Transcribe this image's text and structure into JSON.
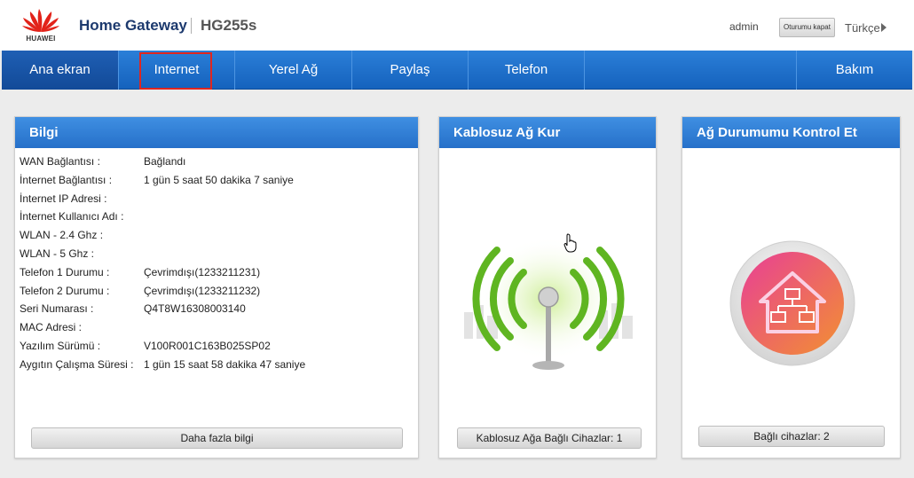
{
  "header": {
    "logo_text": "HUAWEI",
    "title": "Home Gateway",
    "model": "HG255s",
    "user": "admin",
    "logout_label": "Oturumu kapat",
    "language": "Türkçe"
  },
  "nav": {
    "items": [
      {
        "label": "Ana ekran"
      },
      {
        "label": "Internet"
      },
      {
        "label": "Yerel Ağ"
      },
      {
        "label": "Paylaş"
      },
      {
        "label": "Telefon"
      },
      {
        "label": "Bakım"
      }
    ]
  },
  "info_panel": {
    "title": "Bilgi",
    "rows": [
      {
        "key": "WAN Bağlantısı :",
        "value": "Bağlandı"
      },
      {
        "key": "İnternet Bağlantısı :",
        "value": "1 gün 5 saat 50 dakika 7 saniye"
      },
      {
        "key": "İnternet IP Adresi :",
        "value": ""
      },
      {
        "key": "İnternet Kullanıcı Adı :",
        "value": ""
      },
      {
        "key": "WLAN - 2.4 Ghz :",
        "value": ""
      },
      {
        "key": "WLAN - 5 Ghz :",
        "value": ""
      },
      {
        "key": "Telefon 1 Durumu :",
        "value": "Çevrimdışı(1233211231)"
      },
      {
        "key": "Telefon 2 Durumu :",
        "value": "Çevrimdışı(1233211232)"
      },
      {
        "key": "Seri Numarası :",
        "value": "Q4T8W16308003140"
      },
      {
        "key": "MAC Adresi :",
        "value": ""
      },
      {
        "key": "Yazılım Sürümü :",
        "value": "V100R001C163B025SP02"
      },
      {
        "key": "Aygıtın Çalışma Süresi :",
        "value": "1 gün 15 saat 58 dakika 47 saniye"
      }
    ],
    "more_button": "Daha fazla bilgi"
  },
  "wireless_panel": {
    "title": "Kablosuz Ağ Kur",
    "connected_label": "Kablosuz Ağa Bağlı Cihazlar: 1"
  },
  "network_panel": {
    "title": "Ağ Durumumu Kontrol Et",
    "connected_label": "Bağlı cihazlar: 2"
  },
  "colors": {
    "nav_blue": "#1e6fcf",
    "panel_head_blue": "#2f7fd6",
    "highlight_red": "#e0261f",
    "wifi_green": "#5fb521",
    "house_pink": "#e2488f",
    "house_orange": "#f0893a"
  }
}
